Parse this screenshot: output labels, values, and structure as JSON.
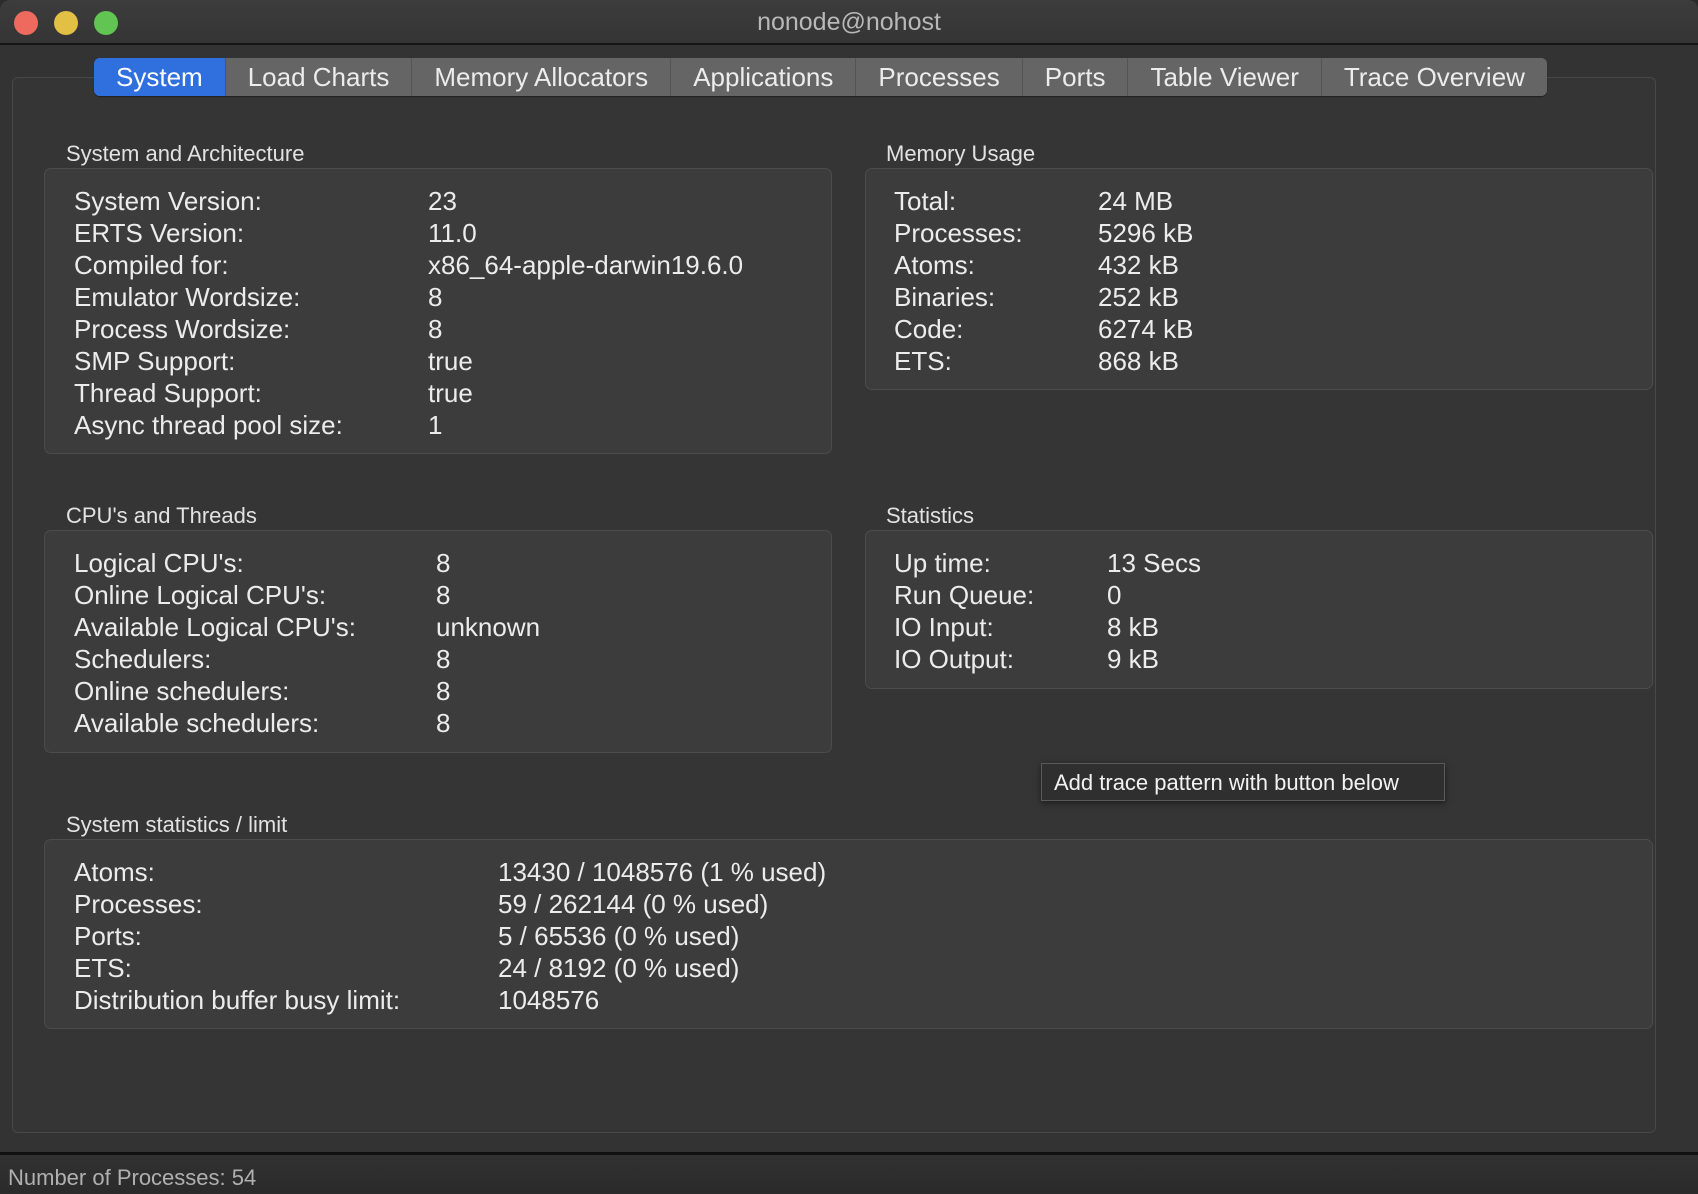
{
  "window": {
    "title": "nonode@nohost"
  },
  "tabs": [
    {
      "label": "System",
      "active": true
    },
    {
      "label": "Load Charts"
    },
    {
      "label": "Memory Allocators"
    },
    {
      "label": "Applications"
    },
    {
      "label": "Processes"
    },
    {
      "label": "Ports"
    },
    {
      "label": "Table Viewer"
    },
    {
      "label": "Trace Overview"
    }
  ],
  "system_arch": {
    "title": "System and Architecture",
    "rows": [
      {
        "label": "System Version:",
        "value": "23"
      },
      {
        "label": "ERTS Version:",
        "value": "11.0"
      },
      {
        "label": "Compiled for:",
        "value": "x86_64-apple-darwin19.6.0"
      },
      {
        "label": "Emulator Wordsize:",
        "value": "8"
      },
      {
        "label": "Process Wordsize:",
        "value": "8"
      },
      {
        "label": "SMP Support:",
        "value": "true"
      },
      {
        "label": "Thread Support:",
        "value": "true"
      },
      {
        "label": "Async thread pool size:",
        "value": "1"
      }
    ]
  },
  "memory": {
    "title": "Memory Usage",
    "rows": [
      {
        "label": "Total:",
        "value": "24 MB"
      },
      {
        "label": "Processes:",
        "value": "5296 kB"
      },
      {
        "label": "Atoms:",
        "value": "432 kB"
      },
      {
        "label": "Binaries:",
        "value": "252 kB"
      },
      {
        "label": "Code:",
        "value": "6274 kB"
      },
      {
        "label": "ETS:",
        "value": "868 kB"
      }
    ]
  },
  "cpus": {
    "title": "CPU's and Threads",
    "rows": [
      {
        "label": "Logical CPU's:",
        "value": "8"
      },
      {
        "label": "Online Logical CPU's:",
        "value": "8"
      },
      {
        "label": "Available Logical CPU's:",
        "value": "unknown"
      },
      {
        "label": "Schedulers:",
        "value": "8"
      },
      {
        "label": "Online schedulers:",
        "value": "8"
      },
      {
        "label": "Available schedulers:",
        "value": "8"
      }
    ]
  },
  "statistics": {
    "title": "Statistics",
    "rows": [
      {
        "label": "Up time:",
        "value": "13 Secs"
      },
      {
        "label": "Run Queue:",
        "value": "0"
      },
      {
        "label": "IO Input:",
        "value": "8 kB"
      },
      {
        "label": "IO Output:",
        "value": "9 kB"
      }
    ]
  },
  "limits": {
    "title": "System statistics / limit",
    "rows": [
      {
        "label": "Atoms:",
        "value": "13430 / 1048576 (1 % used)"
      },
      {
        "label": "Processes:",
        "value": "59 / 262144 (0 % used)"
      },
      {
        "label": "Ports:",
        "value": "5 / 65536 (0 % used)"
      },
      {
        "label": "ETS:",
        "value": "24 / 8192 (0 % used)"
      },
      {
        "label": "Distribution buffer busy limit:",
        "value": "1048576"
      }
    ]
  },
  "tooltip": {
    "text": "Add trace pattern with button below"
  },
  "status": {
    "text": "Number of Processes: 54"
  }
}
